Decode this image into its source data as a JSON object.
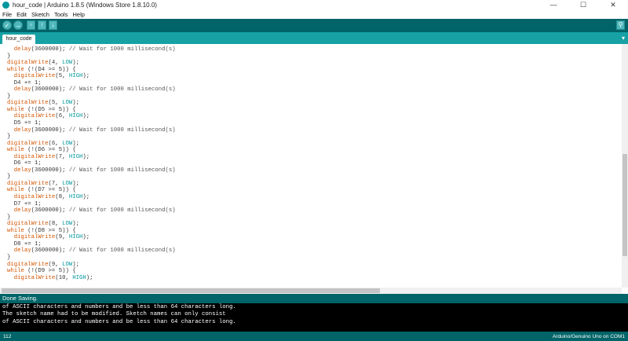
{
  "window": {
    "title": "hour_code | Arduino 1.8.5 (Windows Store 1.8.10.0)",
    "minimize": "—",
    "maximize": "☐",
    "close": "✕"
  },
  "menu": [
    "File",
    "Edit",
    "Sketch",
    "Tools",
    "Help"
  ],
  "toolbar": {
    "verify": "✓",
    "upload": "→",
    "new": "▫",
    "open": "↑",
    "save": "↓",
    "serial_monitor": "⚲"
  },
  "tabs": {
    "active": "hour_code",
    "menu_icon": "▾"
  },
  "status": {
    "message": "Done Saving."
  },
  "console_lines": [
    "of ASCII characters and numbers and be less than 64 characters long.",
    "The sketch name had to be modified. Sketch names can only consist",
    "of ASCII characters and numbers and be less than 64 characters long."
  ],
  "footer": {
    "line_number": "112",
    "board": "Arduino/Genuino Uno on COM1"
  },
  "colors": {
    "teal_dark": "#006468",
    "teal_light": "#17a1a5",
    "button": "#4db7bb",
    "keyword_orange": "#d35400"
  }
}
